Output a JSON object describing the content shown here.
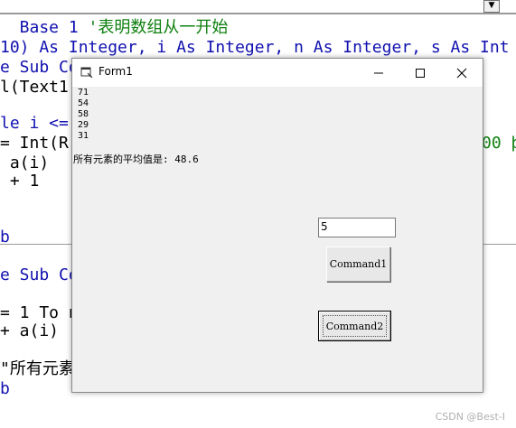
{
  "editor": {
    "scroll_arrow": "▼",
    "lines": [
      {
        "pre": "",
        "kw": "",
        "text": "  Base 1 ",
        "cm": "'表明数组从一开始"
      },
      {
        "pre": "",
        "kw": "",
        "text": "10) As Integer, i As Integer, n As Integer, s As Int",
        "cm": ""
      },
      {
        "pre": "",
        "kw": "",
        "text": "e Sub Co",
        "cm": ""
      },
      {
        "pre": "",
        "kw": "",
        "text": "l(Text1.",
        "cm": ""
      },
      {
        "pre": "",
        "kw": "",
        "text": "le i <=",
        "cm": ""
      },
      {
        "pre": "",
        "kw": "",
        "text": "= Int(R",
        "cm": ""
      },
      {
        "pre": "",
        "kw": "",
        "text": " a(i)",
        "cm": ""
      },
      {
        "pre": "",
        "kw": "",
        "text": " + 1",
        "cm": ""
      },
      {
        "pre": "",
        "kw": "",
        "text": "b",
        "cm": ""
      },
      {
        "pre": "",
        "kw": "",
        "text": "e Sub Co",
        "cm": ""
      },
      {
        "pre": "",
        "kw": "",
        "text": "= 1 To n",
        "cm": ""
      },
      {
        "pre": "",
        "kw": "",
        "text": "+ a(i)",
        "cm": ""
      },
      {
        "pre": "",
        "kw": "",
        "text": "\"所有元素",
        "cm": ""
      },
      {
        "pre": "",
        "kw": "",
        "text": "b",
        "cm": ""
      }
    ],
    "right_fragment": "00 þ"
  },
  "window": {
    "title": "Form1",
    "icon": "form-icon",
    "controls": {
      "minimize": "minimize-icon",
      "maximize": "maximize-icon",
      "close": "close-icon"
    }
  },
  "form": {
    "numbers": [
      "71",
      "54",
      "58",
      "29",
      "31"
    ],
    "average_text": "所有元素的平均值是: 48.6",
    "textbox_value": "5",
    "command1_label": "Command1",
    "command2_label": "Command2"
  },
  "watermark": "CSDN @Best-I"
}
